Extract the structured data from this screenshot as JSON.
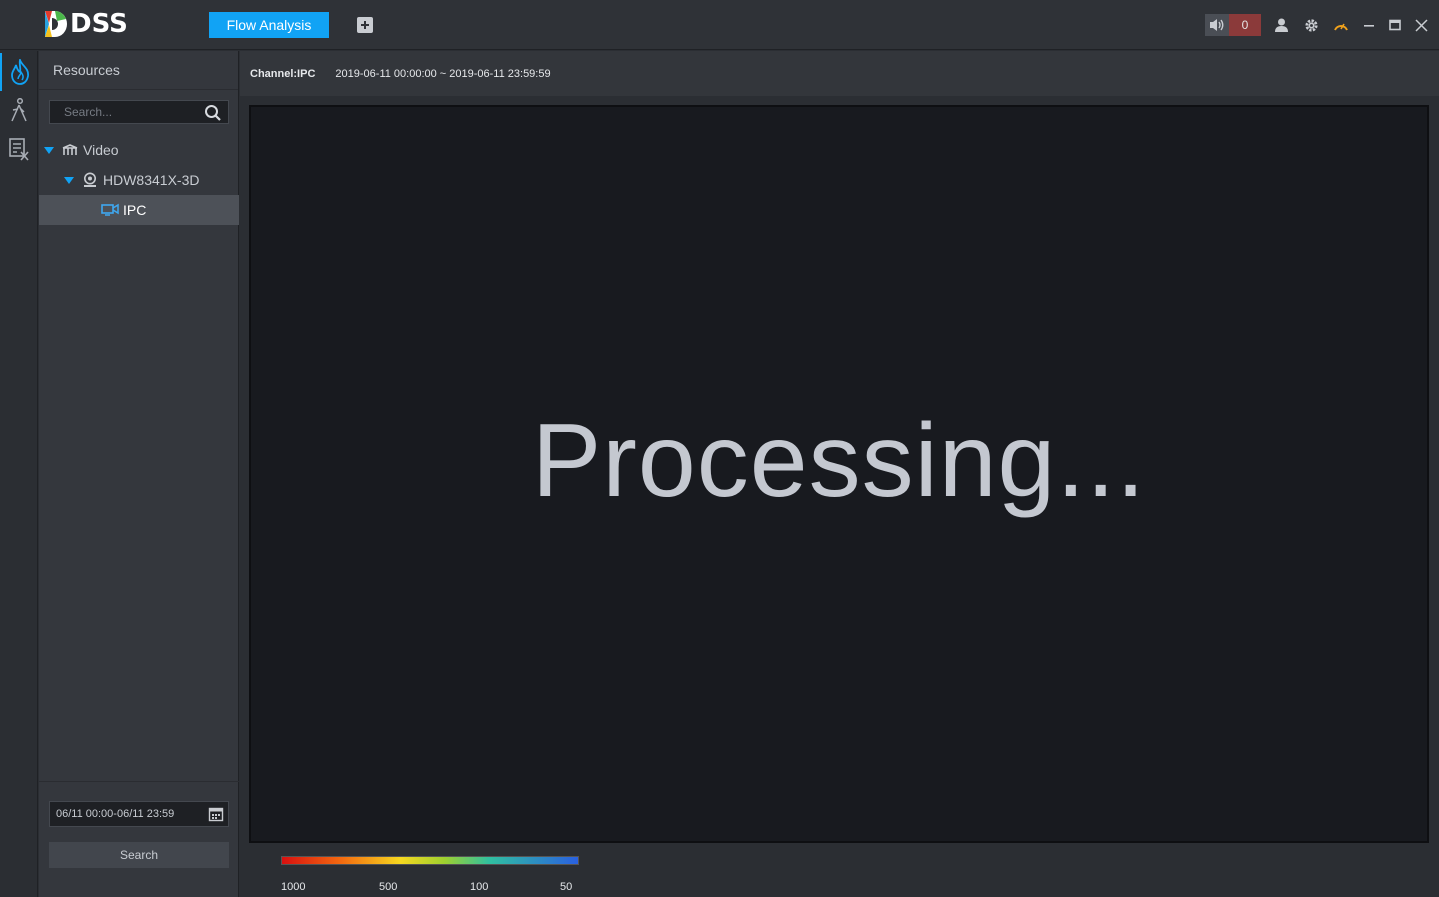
{
  "app": {
    "name": "DSS"
  },
  "tabs": [
    {
      "label": "Flow Analysis",
      "active": true
    }
  ],
  "header": {
    "alarm_count": "0"
  },
  "resources": {
    "title": "Resources",
    "search_placeholder": "Search...",
    "tree": [
      {
        "label": "Video",
        "icon": "video-group-icon",
        "expanded": true
      },
      {
        "label": "HDW8341X-3D",
        "icon": "device-icon",
        "expanded": true
      },
      {
        "label": "IPC",
        "icon": "ipc-camera-icon",
        "selected": true
      }
    ],
    "date_range": "06/11 00:00-06/11 23:59",
    "search_button": "Search"
  },
  "main": {
    "channel": "Channel:IPC",
    "time_range": "2019-06-11 00:00:00 ~ 2019-06-11 23:59:59",
    "status_text": "Processing...",
    "legend": [
      "1000",
      "500",
      "100",
      "50"
    ]
  },
  "colors": {
    "accent": "#11a3f5",
    "alarm": "#8b3a3a"
  }
}
